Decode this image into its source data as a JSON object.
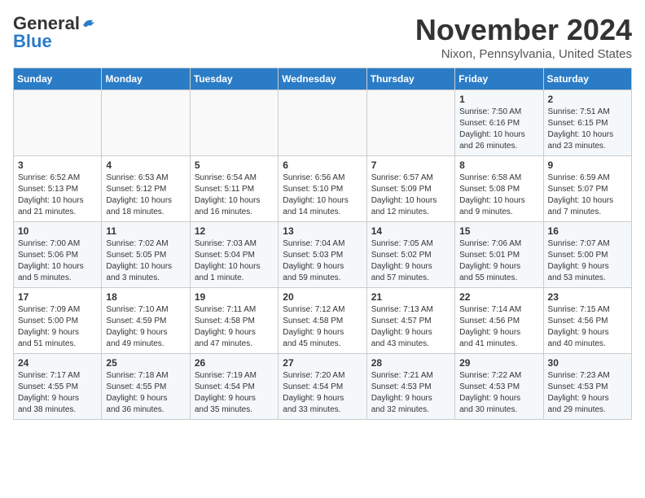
{
  "header": {
    "logo_general": "General",
    "logo_blue": "Blue",
    "month_title": "November 2024",
    "location": "Nixon, Pennsylvania, United States"
  },
  "weekdays": [
    "Sunday",
    "Monday",
    "Tuesday",
    "Wednesday",
    "Thursday",
    "Friday",
    "Saturday"
  ],
  "weeks": [
    [
      {
        "day": "",
        "info": "",
        "empty": true
      },
      {
        "day": "",
        "info": "",
        "empty": true
      },
      {
        "day": "",
        "info": "",
        "empty": true
      },
      {
        "day": "",
        "info": "",
        "empty": true
      },
      {
        "day": "",
        "info": "",
        "empty": true
      },
      {
        "day": "1",
        "info": "Sunrise: 7:50 AM\nSunset: 6:16 PM\nDaylight: 10 hours\nand 26 minutes."
      },
      {
        "day": "2",
        "info": "Sunrise: 7:51 AM\nSunset: 6:15 PM\nDaylight: 10 hours\nand 23 minutes."
      }
    ],
    [
      {
        "day": "3",
        "info": "Sunrise: 6:52 AM\nSunset: 5:13 PM\nDaylight: 10 hours\nand 21 minutes."
      },
      {
        "day": "4",
        "info": "Sunrise: 6:53 AM\nSunset: 5:12 PM\nDaylight: 10 hours\nand 18 minutes."
      },
      {
        "day": "5",
        "info": "Sunrise: 6:54 AM\nSunset: 5:11 PM\nDaylight: 10 hours\nand 16 minutes."
      },
      {
        "day": "6",
        "info": "Sunrise: 6:56 AM\nSunset: 5:10 PM\nDaylight: 10 hours\nand 14 minutes."
      },
      {
        "day": "7",
        "info": "Sunrise: 6:57 AM\nSunset: 5:09 PM\nDaylight: 10 hours\nand 12 minutes."
      },
      {
        "day": "8",
        "info": "Sunrise: 6:58 AM\nSunset: 5:08 PM\nDaylight: 10 hours\nand 9 minutes."
      },
      {
        "day": "9",
        "info": "Sunrise: 6:59 AM\nSunset: 5:07 PM\nDaylight: 10 hours\nand 7 minutes."
      }
    ],
    [
      {
        "day": "10",
        "info": "Sunrise: 7:00 AM\nSunset: 5:06 PM\nDaylight: 10 hours\nand 5 minutes."
      },
      {
        "day": "11",
        "info": "Sunrise: 7:02 AM\nSunset: 5:05 PM\nDaylight: 10 hours\nand 3 minutes."
      },
      {
        "day": "12",
        "info": "Sunrise: 7:03 AM\nSunset: 5:04 PM\nDaylight: 10 hours\nand 1 minute."
      },
      {
        "day": "13",
        "info": "Sunrise: 7:04 AM\nSunset: 5:03 PM\nDaylight: 9 hours\nand 59 minutes."
      },
      {
        "day": "14",
        "info": "Sunrise: 7:05 AM\nSunset: 5:02 PM\nDaylight: 9 hours\nand 57 minutes."
      },
      {
        "day": "15",
        "info": "Sunrise: 7:06 AM\nSunset: 5:01 PM\nDaylight: 9 hours\nand 55 minutes."
      },
      {
        "day": "16",
        "info": "Sunrise: 7:07 AM\nSunset: 5:00 PM\nDaylight: 9 hours\nand 53 minutes."
      }
    ],
    [
      {
        "day": "17",
        "info": "Sunrise: 7:09 AM\nSunset: 5:00 PM\nDaylight: 9 hours\nand 51 minutes."
      },
      {
        "day": "18",
        "info": "Sunrise: 7:10 AM\nSunset: 4:59 PM\nDaylight: 9 hours\nand 49 minutes."
      },
      {
        "day": "19",
        "info": "Sunrise: 7:11 AM\nSunset: 4:58 PM\nDaylight: 9 hours\nand 47 minutes."
      },
      {
        "day": "20",
        "info": "Sunrise: 7:12 AM\nSunset: 4:58 PM\nDaylight: 9 hours\nand 45 minutes."
      },
      {
        "day": "21",
        "info": "Sunrise: 7:13 AM\nSunset: 4:57 PM\nDaylight: 9 hours\nand 43 minutes."
      },
      {
        "day": "22",
        "info": "Sunrise: 7:14 AM\nSunset: 4:56 PM\nDaylight: 9 hours\nand 41 minutes."
      },
      {
        "day": "23",
        "info": "Sunrise: 7:15 AM\nSunset: 4:56 PM\nDaylight: 9 hours\nand 40 minutes."
      }
    ],
    [
      {
        "day": "24",
        "info": "Sunrise: 7:17 AM\nSunset: 4:55 PM\nDaylight: 9 hours\nand 38 minutes."
      },
      {
        "day": "25",
        "info": "Sunrise: 7:18 AM\nSunset: 4:55 PM\nDaylight: 9 hours\nand 36 minutes."
      },
      {
        "day": "26",
        "info": "Sunrise: 7:19 AM\nSunset: 4:54 PM\nDaylight: 9 hours\nand 35 minutes."
      },
      {
        "day": "27",
        "info": "Sunrise: 7:20 AM\nSunset: 4:54 PM\nDaylight: 9 hours\nand 33 minutes."
      },
      {
        "day": "28",
        "info": "Sunrise: 7:21 AM\nSunset: 4:53 PM\nDaylight: 9 hours\nand 32 minutes."
      },
      {
        "day": "29",
        "info": "Sunrise: 7:22 AM\nSunset: 4:53 PM\nDaylight: 9 hours\nand 30 minutes."
      },
      {
        "day": "30",
        "info": "Sunrise: 7:23 AM\nSunset: 4:53 PM\nDaylight: 9 hours\nand 29 minutes."
      }
    ]
  ]
}
